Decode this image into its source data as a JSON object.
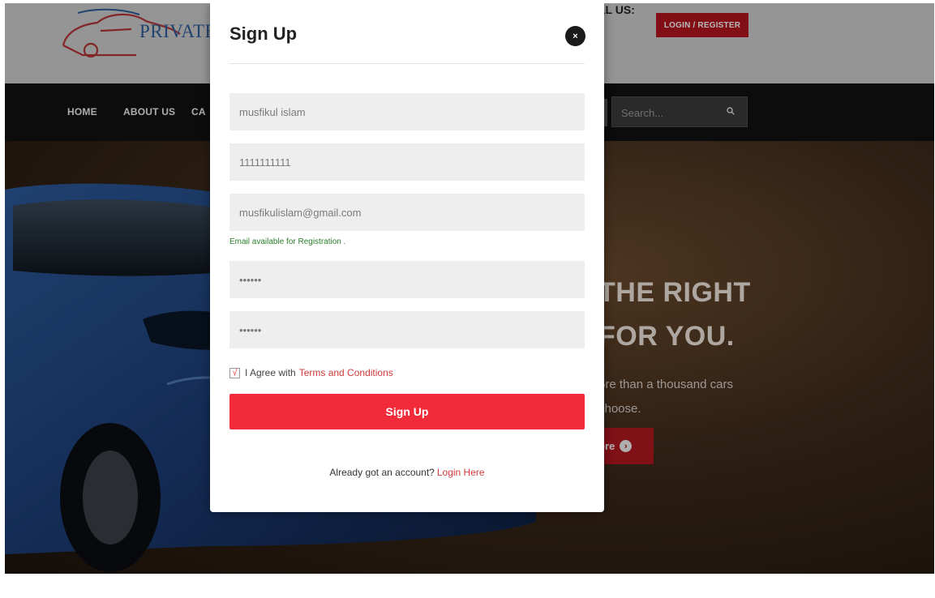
{
  "header": {
    "logo_text": "PRIVATE",
    "call_label": "LL US:",
    "login_register": "LOGIN / REGISTER"
  },
  "nav": {
    "items": [
      "HOME",
      "ABOUT US",
      "CA"
    ],
    "search_placeholder": "Search..."
  },
  "hero": {
    "title_line1": "THE RIGHT",
    "title_line2": "FOR YOU.",
    "sub_line1": "ore than a thousand cars",
    "sub_line2": "choose.",
    "more_label": "ore"
  },
  "modal": {
    "title": "Sign Up",
    "close_label": "×",
    "fields": {
      "name": "musfikul islam",
      "phone": "1111111111",
      "email": "musfikulislam@gmail.com",
      "password": "••••••",
      "confirm_password": "••••••"
    },
    "email_status": "Email available for Registration .",
    "agree_text": "I Agree with",
    "terms_link": "Terms and Conditions",
    "checkbox_mark": "√",
    "submit_label": "Sign Up",
    "already_text": "Already got an account?",
    "login_link": "Login Here"
  },
  "colors": {
    "accent": "#f22b3a",
    "header_button": "#b4161f",
    "success": "#2a7d2a"
  }
}
